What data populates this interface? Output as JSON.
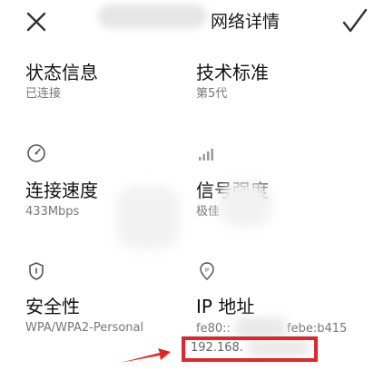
{
  "header": {
    "title": "网络详情",
    "close_icon": "close-icon",
    "confirm_icon": "check-icon"
  },
  "items": {
    "status": {
      "label": "状态信息",
      "value": "已连接"
    },
    "standard": {
      "label": "技术标准",
      "value": "第5代"
    },
    "speed": {
      "label": "连接速度",
      "value": "433Mbps",
      "icon": "speedometer-icon"
    },
    "signal": {
      "label": "信号强度",
      "value": "极佳",
      "icon": "signal-bars-icon"
    },
    "security": {
      "label": "安全性",
      "value": "WPA/WPA2-Personal",
      "icon": "shield-icon"
    },
    "ip": {
      "label": "IP 地址",
      "icon": "ip-location-icon",
      "ipv6_start": "fe80::",
      "ipv6_end": "febe:b415",
      "ipv4": "192.168."
    }
  },
  "annotation": {
    "highlight_color": "#e0262b"
  }
}
